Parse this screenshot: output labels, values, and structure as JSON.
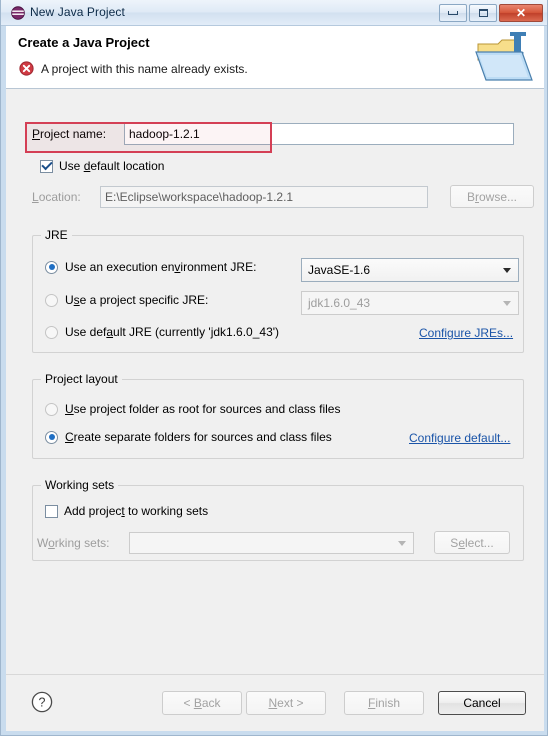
{
  "window": {
    "title": "New Java Project",
    "icon": "eclipse-java-icon",
    "controls": {
      "minimize": "minimize-icon",
      "maximize": "maximize-icon",
      "close": "close-icon"
    }
  },
  "banner": {
    "title": "Create a Java Project",
    "message": "A project with this name already exists.",
    "message_icon": "error-icon",
    "art_icon": "java-project-folder-icon",
    "error_color": "#d43f55"
  },
  "project_name": {
    "label": "Project name:",
    "value": "hadoop-1.2.1",
    "placeholder": ""
  },
  "location": {
    "use_default_label": "Use default location",
    "use_default_checked": true,
    "label": "Location:",
    "value": "E:\\Eclipse\\workspace\\hadoop-1.2.1",
    "browse_label": "Browse..."
  },
  "jre": {
    "group_title": "JRE",
    "options": [
      {
        "label": "Use an execution environment JRE:",
        "selected": true
      },
      {
        "label": "Use a project specific JRE:",
        "selected": false
      },
      {
        "label": "Use default JRE (currently 'jdk1.6.0_43')",
        "selected": false
      }
    ],
    "execution_env_value": "JavaSE-1.6",
    "specific_jre_value": "jdk1.6.0_43",
    "configure_link": "Configure JREs..."
  },
  "project_layout": {
    "group_title": "Project layout",
    "options": [
      {
        "label": "Use project folder as root for sources and class files",
        "selected": false
      },
      {
        "label": "Create separate folders for sources and class files",
        "selected": true
      }
    ],
    "configure_link": "Configure default..."
  },
  "working_sets": {
    "group_title": "Working sets",
    "add_label": "Add project to working sets",
    "add_checked": false,
    "label": "Working sets:",
    "value": "",
    "select_label": "Select..."
  },
  "buttons": {
    "help": "help-icon",
    "back": "< Back",
    "next": "Next >",
    "finish": "Finish",
    "cancel": "Cancel"
  }
}
